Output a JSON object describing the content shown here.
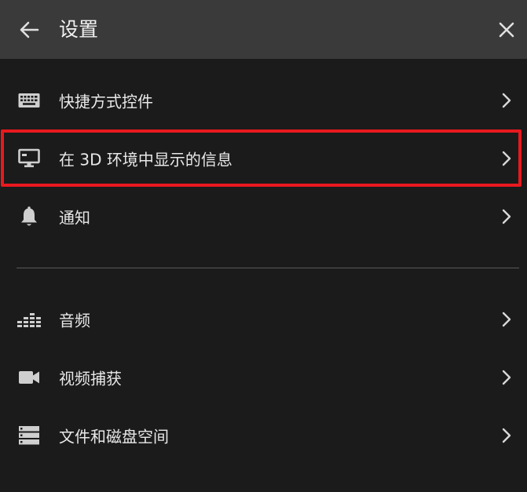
{
  "header": {
    "title": "设置",
    "back_icon": "arrow-left-icon",
    "close_icon": "close-icon"
  },
  "menu_group_1": [
    {
      "label": "快捷方式控件",
      "icon": "keyboard-icon"
    },
    {
      "label": "在 3D 环境中显示的信息",
      "icon": "monitor-icon",
      "highlighted": true
    },
    {
      "label": "通知",
      "icon": "bell-icon"
    }
  ],
  "menu_group_2": [
    {
      "label": "音频",
      "icon": "audio-equalizer-icon"
    },
    {
      "label": "视频捕获",
      "icon": "video-camera-icon"
    },
    {
      "label": "文件和磁盘空间",
      "icon": "storage-icon"
    }
  ],
  "colors": {
    "background": "#1b1b1b",
    "header_background": "#3a3a3a",
    "highlight_border": "#e8191f",
    "text": "#e8e8e8"
  }
}
